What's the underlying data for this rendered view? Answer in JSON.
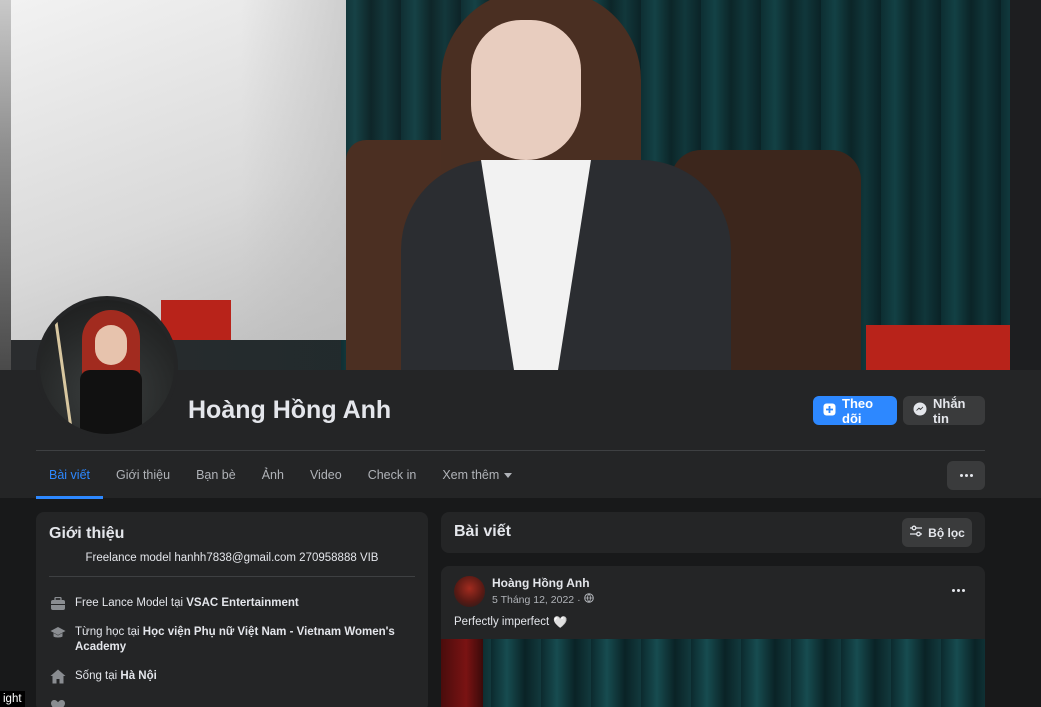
{
  "profile": {
    "name": "Hoàng Hồng Anh",
    "follow_label": "Theo dõi",
    "message_label": "Nhắn tin"
  },
  "tabs": [
    {
      "label": "Bài viết",
      "active": true
    },
    {
      "label": "Giới thiệu"
    },
    {
      "label": "Bạn bè"
    },
    {
      "label": "Ảnh"
    },
    {
      "label": "Video"
    },
    {
      "label": "Check in"
    },
    {
      "label": "Xem thêm"
    }
  ],
  "intro": {
    "title": "Giới thiệu",
    "bio": "Freelance model hanhh7838@gmail.com 270958888 VIB",
    "work_prefix": "Free Lance Model tại ",
    "work_place": "VSAC Entertainment",
    "edu_prefix": "Từng học tại ",
    "edu_place": "Học viện Phụ nữ Việt Nam - Vietnam Women's Academy",
    "lives_prefix": "Sống tại ",
    "lives_place": "Hà Nội"
  },
  "posts": {
    "title": "Bài viết",
    "filter_label": "Bộ lọc",
    "items": [
      {
        "author": "Hoàng Hồng Anh",
        "date": "5 Tháng 12, 2022",
        "text": "Perfectly imperfect",
        "emoji": "🤍"
      }
    ]
  },
  "overlay": {
    "corner_text": "ight"
  },
  "colors": {
    "accent": "#2d88ff",
    "card": "#242526",
    "background": "#18191a"
  }
}
